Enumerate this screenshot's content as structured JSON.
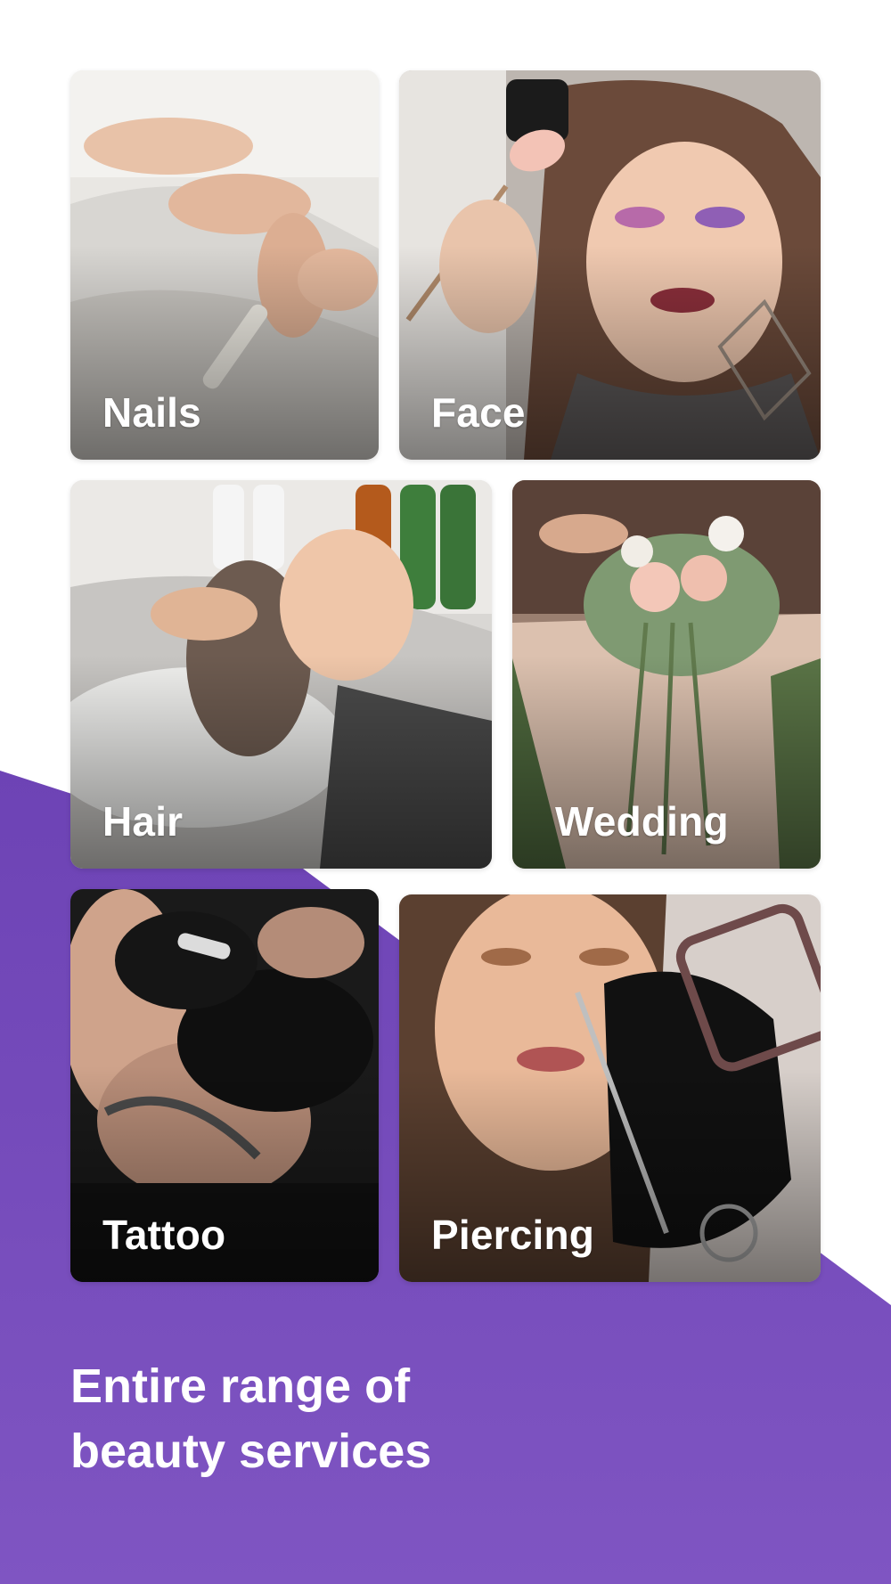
{
  "tiles": [
    {
      "id": "nails",
      "label": "Nails"
    },
    {
      "id": "face",
      "label": "Face"
    },
    {
      "id": "hair",
      "label": "Hair"
    },
    {
      "id": "wedding",
      "label": "Wedding"
    },
    {
      "id": "tattoo",
      "label": "Tattoo"
    },
    {
      "id": "piercing",
      "label": "Piercing"
    }
  ],
  "headline": {
    "line1": "Entire range of",
    "line2": "beauty services"
  },
  "colors": {
    "background": "#ffffff",
    "accent_purple": "#7a4fc0",
    "accent_purple_dark": "#6d43b5",
    "text": "#ffffff"
  }
}
